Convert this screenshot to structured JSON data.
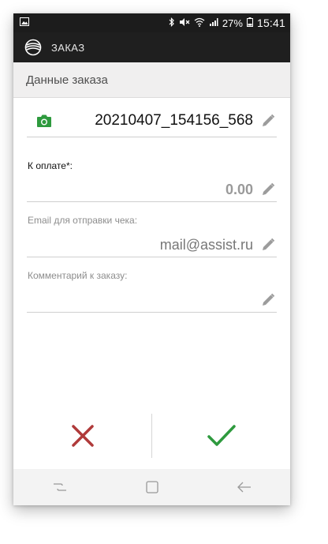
{
  "status_bar": {
    "battery": "27%",
    "time": "15:41",
    "icons": [
      "image-icon",
      "bluetooth-icon",
      "mute-icon",
      "wifi-icon",
      "signal-icon",
      "battery-icon"
    ]
  },
  "app_bar": {
    "title": "ЗАКАЗ",
    "logo_icon": "assist-logo-icon"
  },
  "section": {
    "title": "Данные заказа"
  },
  "order": {
    "number": "20210407_154156_568",
    "camera_icon": "camera-icon"
  },
  "fields": {
    "amount_label": "К оплате*:",
    "amount_value": "0.00",
    "email_label": "Email для отправки чека:",
    "email_value": "mail@assist.ru",
    "comment_label": "Комментарий к заказу:",
    "comment_value": ""
  },
  "actions": {
    "cancel_icon": "close-icon",
    "confirm_icon": "check-icon"
  },
  "colors": {
    "cancel": "#b03a3a",
    "confirm": "#2e9a3e",
    "camera": "#2e9a3e",
    "app_bar": "#1f1f1f"
  }
}
